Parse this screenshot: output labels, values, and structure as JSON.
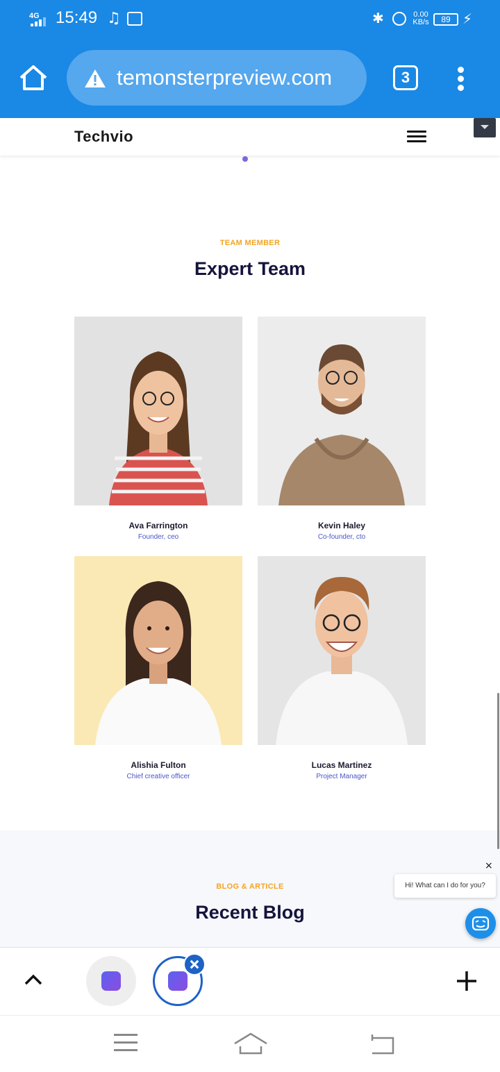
{
  "status_bar": {
    "network": "4G",
    "time": "15:49",
    "speed_value": "0.00",
    "speed_unit": "KB/s",
    "battery": "89"
  },
  "browser": {
    "url": "temonsterpreview.com",
    "tab_count": "3"
  },
  "site": {
    "logo": "Techvio"
  },
  "team_section": {
    "eyebrow": "TEAM MEMBER",
    "title": "Expert Team",
    "members": [
      {
        "name": "Ava Farrington",
        "role": "Founder, ceo"
      },
      {
        "name": "Kevin Haley",
        "role": "Co-founder, cto"
      },
      {
        "name": "Alishia Fulton",
        "role": "Chief creative officer"
      },
      {
        "name": "Lucas Martinez",
        "role": "Project Manager"
      }
    ]
  },
  "blog_section": {
    "eyebrow": "BLOG & ARTICLE",
    "title": "Recent Blog"
  },
  "chat": {
    "greeting": "Hi! What can I do for you?",
    "close": "×"
  },
  "colors": {
    "chrome_blue": "#1a88e5",
    "accent_orange": "#f3a423",
    "title_navy": "#14143c",
    "role_blue": "#4a55c8"
  }
}
